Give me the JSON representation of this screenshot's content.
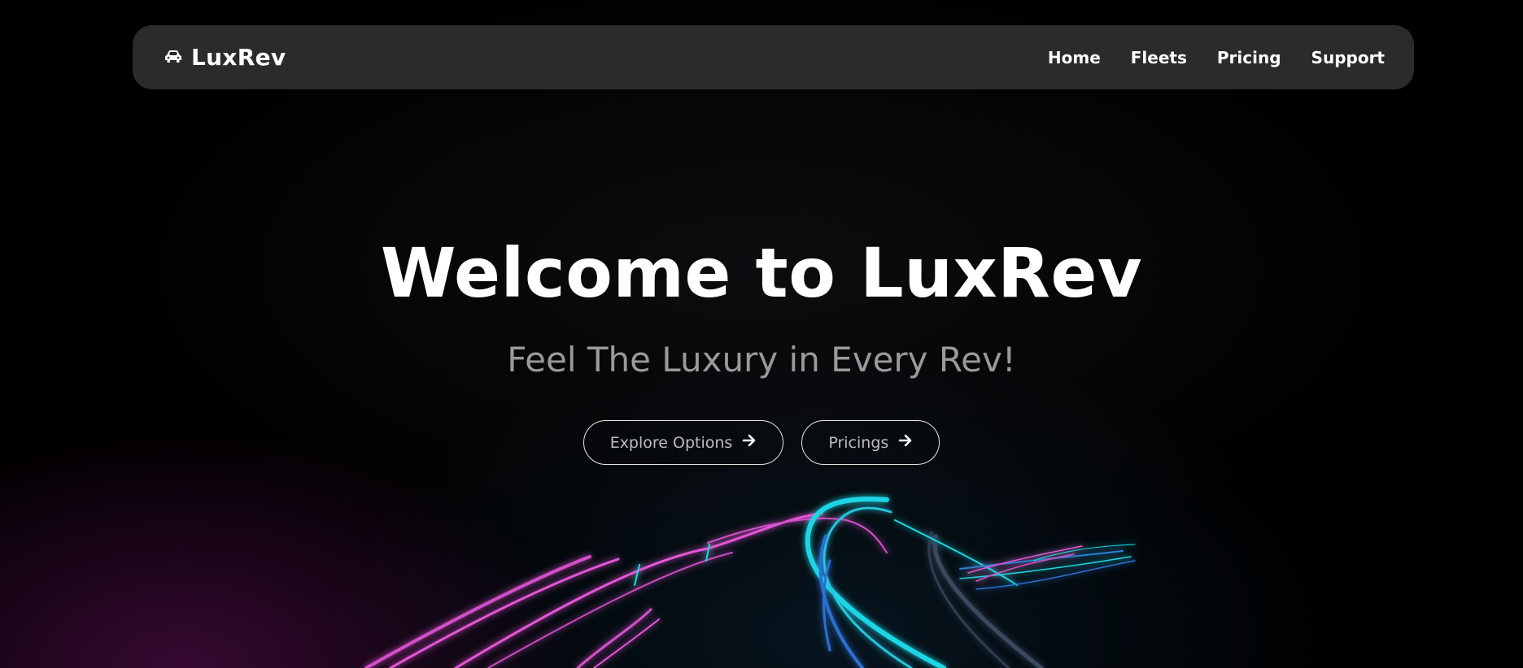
{
  "brand": {
    "name": "LuxRev",
    "icon": "car-icon"
  },
  "nav": {
    "items": [
      {
        "label": "Home"
      },
      {
        "label": "Fleets"
      },
      {
        "label": "Pricing"
      },
      {
        "label": "Support"
      }
    ]
  },
  "hero": {
    "title": "Welcome to LuxRev",
    "tagline": "Feel The Luxury in Every Rev!",
    "buttons": [
      {
        "label": "Explore Options",
        "icon": "arrow-right-icon"
      },
      {
        "label": "Pricings",
        "icon": "arrow-right-icon"
      }
    ]
  },
  "colors": {
    "nav_background": "#2b2b2b",
    "accent_pink": "#e455d6",
    "accent_cyan": "#1fd6e6",
    "text": "#ffffff",
    "muted_text": "#9a9a9a"
  }
}
